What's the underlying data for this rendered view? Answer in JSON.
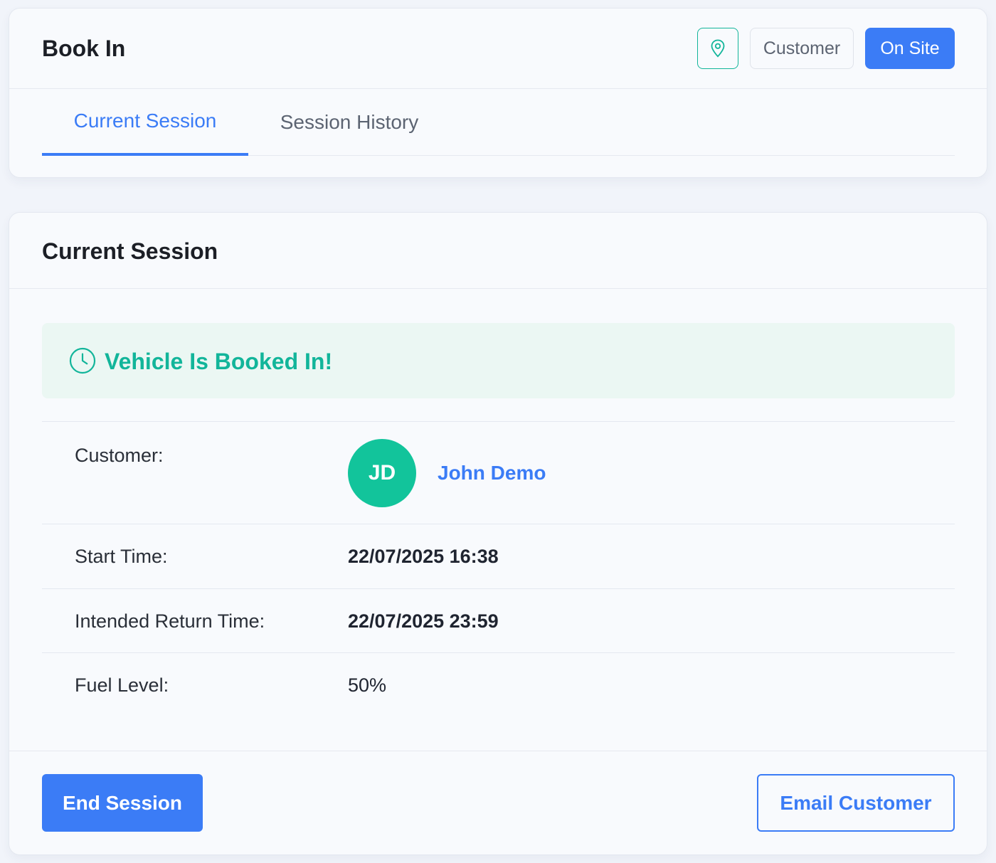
{
  "header": {
    "title": "Book In",
    "location_icon": "map-pin-icon",
    "customer_label": "Customer",
    "on_site_label": "On Site"
  },
  "tabs": [
    {
      "label": "Current Session",
      "active": true
    },
    {
      "label": "Session History",
      "active": false
    }
  ],
  "session": {
    "title": "Current Session",
    "alert": {
      "icon": "clock-icon",
      "text": "Vehicle Is Booked In!"
    },
    "rows": {
      "customer": {
        "label": "Customer:",
        "initials": "JD",
        "name": "John Demo"
      },
      "start_time": {
        "label": "Start Time:",
        "value": "22/07/2025 16:38"
      },
      "return_time": {
        "label": "Intended Return Time:",
        "value": "22/07/2025 23:59"
      },
      "fuel_level": {
        "label": "Fuel Level:",
        "value": "50%"
      }
    }
  },
  "actions": {
    "end_session": "End Session",
    "email_customer": "Email Customer"
  },
  "colors": {
    "primary": "#3b7cf6",
    "success": "#12b59a",
    "avatar": "#12c49b",
    "alert_bg": "#ebf7f3"
  }
}
